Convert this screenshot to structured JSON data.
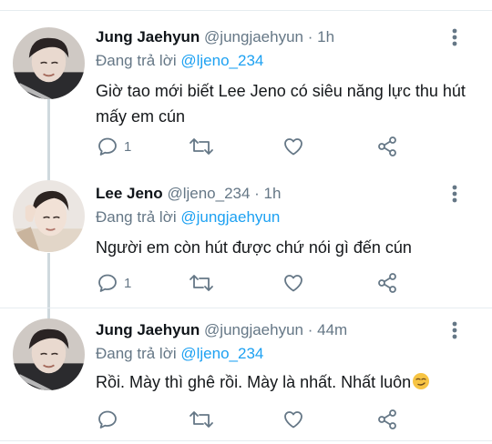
{
  "tweets": [
    {
      "name": "Jung Jaehyun",
      "handle": "@jungjaehyun",
      "dot": " · ",
      "time": "1h",
      "reply_prefix": "Đang trả lời ",
      "reply_to": "@ljeno_234",
      "text": "Giờ tao mới biết Lee Jeno có siêu năng lực thu hút mấy em cún",
      "reply_count": "1",
      "avatar": "avatar-photo-jaehyun"
    },
    {
      "name": "Lee Jeno",
      "handle": "@ljeno_234",
      "dot": " · ",
      "time": "1h",
      "reply_prefix": "Đang trả lời ",
      "reply_to": "@jungjaehyun",
      "text": "Người em còn hút được chứ nói gì đến cún",
      "reply_count": "1",
      "avatar": "avatar-photo-jeno"
    },
    {
      "name": "Jung Jaehyun",
      "handle": "@jungjaehyun",
      "dot": " · ",
      "time": "44m",
      "reply_prefix": "Đang trả lời ",
      "reply_to": "@ljeno_234",
      "text": "Rồi. Mày thì ghê rồi. Mày là nhất. Nhất luôn",
      "reply_count": "",
      "avatar": "avatar-photo-jaehyun"
    }
  ],
  "icons": {
    "reply": "reply-icon",
    "retweet": "retweet-icon",
    "like": "heart-icon",
    "share": "share-icon",
    "more": "more-vertical-icon",
    "emoji": "smirk-emoji-icon"
  },
  "colors": {
    "mention": "#1da1f2",
    "secondary_text": "#657786",
    "icon": "#657786",
    "thread_line": "#cfd9de"
  }
}
